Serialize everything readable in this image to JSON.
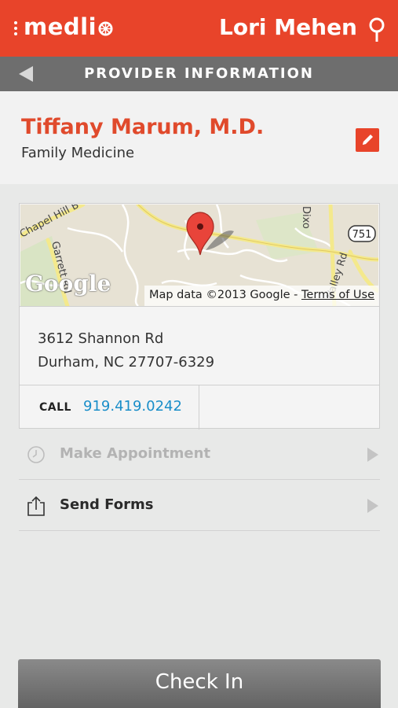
{
  "header": {
    "brand": "medli",
    "user_name": "Lori Mehen"
  },
  "section": {
    "title": "PROVIDER INFORMATION"
  },
  "provider": {
    "name": "Tiffany Marum, M.D.",
    "specialty": "Family Medicine"
  },
  "map": {
    "google_logo": "Google",
    "attribution": "Map data ©2013 Google - ",
    "terms": "Terms of Use",
    "labels": {
      "road_chapel_hill": "Chapel Hill B",
      "road_garrett": "Garrett Rd",
      "road_dixon": "Dixo",
      "road_valley": "Valley Rd",
      "route": "751"
    }
  },
  "address": {
    "line1": "3612 Shannon Rd",
    "line2": "Durham, NC 27707-6329"
  },
  "contact": {
    "call_label": "CALL",
    "phone": "919.419.0242"
  },
  "actions": {
    "make_appointment": "Make Appointment",
    "send_forms": "Send Forms"
  },
  "footer": {
    "check_in": "Check In"
  },
  "colors": {
    "brand": "#e8442a",
    "section_bar": "#6e6e6e",
    "link": "#1a8ec9"
  }
}
